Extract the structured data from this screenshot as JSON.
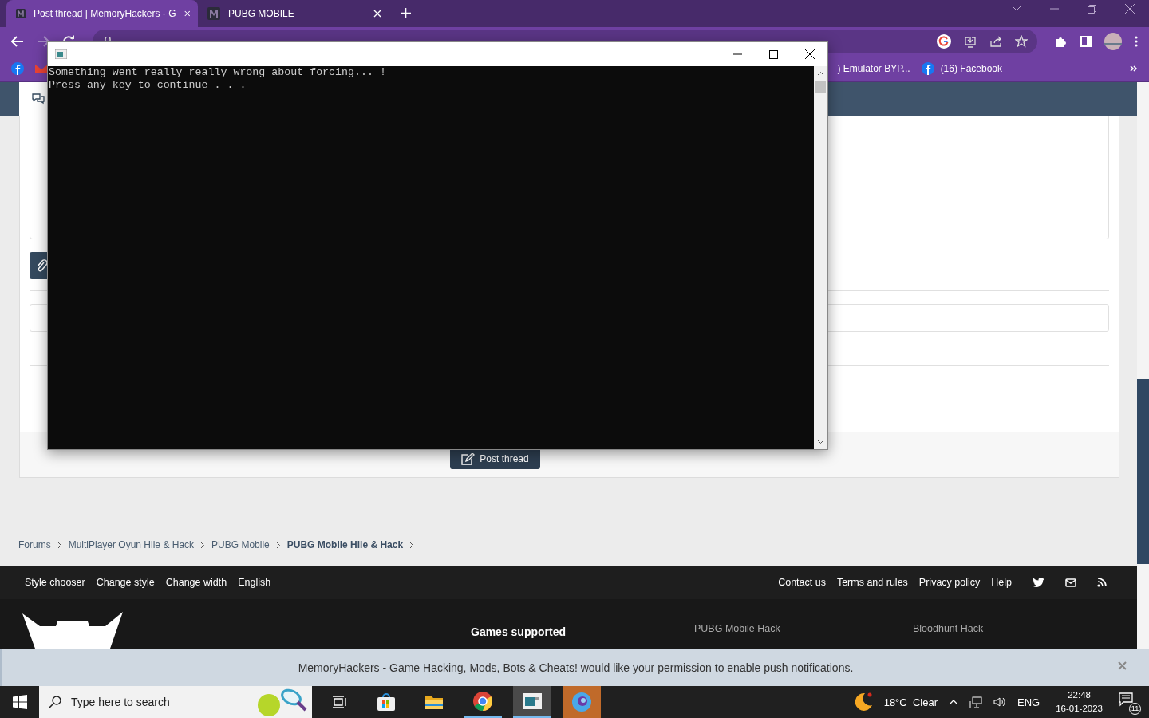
{
  "browser": {
    "tabs": [
      {
        "title": "Post thread | MemoryHackers - G",
        "selected": true
      },
      {
        "title": "PUBG MOBILE",
        "selected": false
      }
    ],
    "bookmarks": [
      {
        "kind": "facebook"
      },
      {
        "kind": "gmail"
      },
      {
        "kind": "spacer"
      },
      {
        "kind": "text",
        "label": ") Emulator BYP..."
      },
      {
        "kind": "facebook",
        "label": "(16) Facebook"
      }
    ]
  },
  "page": {
    "post_button": "Post thread",
    "breadcrumbs": [
      {
        "label": "Forums",
        "current": false
      },
      {
        "label": "MultiPlayer Oyun Hile & Hack",
        "current": false
      },
      {
        "label": "PUBG Mobile",
        "current": false
      },
      {
        "label": "PUBG Mobile Hile & Hack",
        "current": true
      }
    ],
    "footer_left": [
      "Style chooser",
      "Change style",
      "Change width",
      "English"
    ],
    "footer_right": [
      "Contact us",
      "Terms and rules",
      "Privacy policy",
      "Help"
    ],
    "games_heading": "Games supported",
    "game_links": [
      "PUBG Mobile Hack",
      "Bloodhunt Hack"
    ],
    "notification": {
      "text": "MemoryHackers - Game Hacking, Mods, Bots & Cheats! would like your permission to ",
      "link": "enable push notifications",
      "end": "."
    }
  },
  "console": {
    "lines": [
      "Something went really really wrong about forcing... !",
      "Press any key to continue . . ."
    ]
  },
  "taskbar": {
    "search_placeholder": "Type here to search",
    "weather": "18°C  Clear",
    "language": "ENG",
    "time": "22:48",
    "date": "16-01-2023",
    "notifications": "11"
  }
}
